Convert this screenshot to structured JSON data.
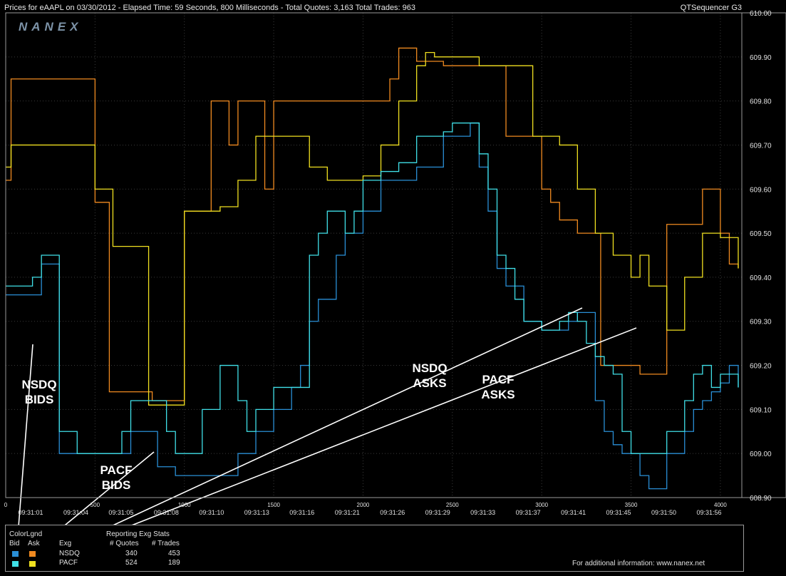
{
  "header": {
    "left_text": "Prices for  eAAPL  on  03/30/2012  -  Elapsed Time: 59 Seconds, 800 Milliseconds  -  Total Quotes: 3,163  Total Trades: 963",
    "right_text": "QTSequencer G3"
  },
  "logo": "NANEX",
  "colors": {
    "nsdq_bid": "#2a8fd6",
    "nsdq_ask": "#f08a20",
    "pacf_bid": "#40e0e8",
    "pacf_ask": "#f0e020",
    "annotation": "#ffffff"
  },
  "chart_data": {
    "type": "line",
    "title": "",
    "xlabel": "",
    "ylabel": "",
    "x_ticks": [
      0,
      500,
      1000,
      1500,
      2000,
      2500,
      3000,
      3500,
      4000
    ],
    "time_labels": [
      "09:31:01",
      "09:31:04",
      "09:31:05",
      "09:31:08",
      "09:31:10",
      "09:31:13",
      "09:31:16",
      "09:31:21",
      "09:31:26",
      "09:31:29",
      "09:31:33",
      "09:31:37",
      "09:31:41",
      "09:31:45",
      "09:31:50",
      "09:31:56"
    ],
    "y_ticks": [
      "608.90",
      "609.00",
      "609.10",
      "609.20",
      "609.30",
      "609.40",
      "609.50",
      "609.60",
      "609.70",
      "609.80",
      "609.90",
      "610.00"
    ],
    "xlim": [
      0,
      4120
    ],
    "ylim": [
      608.9,
      610.0
    ],
    "series": [
      {
        "name": "NSDQ Ask",
        "color": "#f08a20",
        "x": [
          0,
          30,
          140,
          500,
          560,
          580,
          650,
          820,
          860,
          900,
          1000,
          1100,
          1150,
          1200,
          1250,
          1300,
          1400,
          1450,
          1500,
          1600,
          1700,
          1800,
          1950,
          2050,
          2100,
          2150,
          2200,
          2250,
          2300,
          2400,
          2450,
          2550,
          2650,
          2700,
          2800,
          2850,
          2900,
          3000,
          3050,
          3100,
          3200,
          3300,
          3330,
          3400,
          3450,
          3550,
          3600,
          3700,
          3800,
          3850,
          3900,
          3950,
          4000,
          4050,
          4100
        ],
        "y": [
          609.62,
          609.85,
          609.85,
          609.57,
          609.57,
          609.14,
          609.14,
          609.12,
          609.12,
          609.12,
          609.55,
          609.55,
          609.8,
          609.8,
          609.7,
          609.8,
          609.8,
          609.6,
          609.8,
          609.8,
          609.8,
          609.8,
          609.8,
          609.8,
          609.8,
          609.85,
          609.92,
          609.92,
          609.89,
          609.89,
          609.88,
          609.88,
          609.88,
          609.88,
          609.72,
          609.72,
          609.72,
          609.6,
          609.57,
          609.53,
          609.5,
          609.5,
          609.2,
          609.2,
          609.2,
          609.18,
          609.18,
          609.52,
          609.52,
          609.52,
          609.6,
          609.6,
          609.5,
          609.43,
          609.42
        ]
      },
      {
        "name": "PACF Ask",
        "color": "#f0e020",
        "x": [
          0,
          30,
          60,
          300,
          450,
          500,
          600,
          800,
          860,
          900,
          1000,
          1050,
          1200,
          1300,
          1350,
          1400,
          1500,
          1600,
          1700,
          1800,
          1950,
          2000,
          2100,
          2200,
          2300,
          2350,
          2400,
          2500,
          2600,
          2650,
          2700,
          2800,
          2950,
          3000,
          3100,
          3200,
          3300,
          3400,
          3500,
          3550,
          3600,
          3700,
          3800,
          3900,
          3950,
          4000,
          4050,
          4100
        ],
        "y": [
          609.65,
          609.7,
          609.7,
          609.7,
          609.7,
          609.6,
          609.47,
          609.11,
          609.11,
          609.11,
          609.55,
          609.55,
          609.56,
          609.62,
          609.62,
          609.72,
          609.72,
          609.72,
          609.65,
          609.62,
          609.62,
          609.63,
          609.7,
          609.8,
          609.88,
          609.91,
          609.9,
          609.9,
          609.9,
          609.88,
          609.88,
          609.88,
          609.72,
          609.72,
          609.7,
          609.6,
          609.5,
          609.45,
          609.4,
          609.45,
          609.38,
          609.28,
          609.4,
          609.5,
          609.5,
          609.49,
          609.49,
          609.42
        ]
      },
      {
        "name": "NSDQ Bid",
        "color": "#2a8fd6",
        "x": [
          0,
          50,
          100,
          200,
          250,
          300,
          350,
          400,
          450,
          500,
          550,
          600,
          700,
          800,
          850,
          900,
          950,
          1000,
          1050,
          1100,
          1200,
          1300,
          1400,
          1500,
          1550,
          1600,
          1650,
          1700,
          1750,
          1800,
          1850,
          1900,
          1950,
          2000,
          2100,
          2200,
          2300,
          2400,
          2450,
          2500,
          2550,
          2600,
          2650,
          2700,
          2750,
          2800,
          2900,
          3000,
          3100,
          3150,
          3200,
          3250,
          3300,
          3350,
          3400,
          3450,
          3500,
          3550,
          3600,
          3700,
          3800,
          3850,
          3900,
          3950,
          4000,
          4050,
          4100
        ],
        "y": [
          609.36,
          609.36,
          609.36,
          609.43,
          609.43,
          609.0,
          609.0,
          609.0,
          609.0,
          609.0,
          609.0,
          609.0,
          609.05,
          609.05,
          608.97,
          608.97,
          608.95,
          608.95,
          608.95,
          608.95,
          608.95,
          609.0,
          609.05,
          609.1,
          609.1,
          609.15,
          609.2,
          609.3,
          609.35,
          609.35,
          609.45,
          609.5,
          609.5,
          609.55,
          609.62,
          609.62,
          609.65,
          609.65,
          609.72,
          609.72,
          609.72,
          609.75,
          609.65,
          609.55,
          609.42,
          609.38,
          609.3,
          609.28,
          609.28,
          609.3,
          609.32,
          609.32,
          609.12,
          609.05,
          609.02,
          609.0,
          609.0,
          608.95,
          608.92,
          609.0,
          609.05,
          609.1,
          609.12,
          609.14,
          609.16,
          609.2,
          609.15
        ]
      },
      {
        "name": "PACF Bid",
        "color": "#40e0e8",
        "x": [
          0,
          20,
          100,
          150,
          200,
          250,
          300,
          350,
          400,
          450,
          500,
          550,
          600,
          650,
          700,
          800,
          850,
          900,
          950,
          1000,
          1100,
          1200,
          1300,
          1350,
          1400,
          1450,
          1500,
          1600,
          1700,
          1750,
          1800,
          1850,
          1900,
          1950,
          2000,
          2100,
          2200,
          2300,
          2400,
          2450,
          2500,
          2550,
          2600,
          2650,
          2700,
          2750,
          2800,
          2850,
          2900,
          3000,
          3100,
          3150,
          3200,
          3250,
          3300,
          3350,
          3400,
          3450,
          3500,
          3550,
          3600,
          3700,
          3800,
          3850,
          3900,
          3950,
          4000,
          4100
        ],
        "y": [
          609.38,
          609.38,
          609.38,
          609.4,
          609.45,
          609.45,
          609.05,
          609.05,
          609.0,
          609.0,
          609.0,
          609.0,
          609.0,
          609.05,
          609.12,
          609.12,
          609.12,
          609.05,
          609.0,
          609.0,
          609.1,
          609.2,
          609.12,
          609.05,
          609.1,
          609.1,
          609.15,
          609.15,
          609.45,
          609.5,
          609.55,
          609.55,
          609.5,
          609.55,
          609.62,
          609.64,
          609.66,
          609.72,
          609.72,
          609.73,
          609.75,
          609.75,
          609.75,
          609.68,
          609.6,
          609.45,
          609.42,
          609.35,
          609.3,
          609.28,
          609.3,
          609.32,
          609.3,
          609.25,
          609.22,
          609.2,
          609.18,
          609.05,
          609.0,
          609.0,
          609.0,
          609.05,
          609.12,
          609.18,
          609.2,
          609.15,
          609.18,
          609.15
        ]
      }
    ]
  },
  "annotations": [
    {
      "id": "nsdq-bids",
      "lines": [
        "NSDQ",
        "BIDS"
      ]
    },
    {
      "id": "pacf-bids",
      "lines": [
        "PACF",
        "BIDS"
      ]
    },
    {
      "id": "nsdq-asks",
      "lines": [
        "NSDQ",
        "ASKS"
      ]
    },
    {
      "id": "pacf-asks",
      "lines": [
        "PACF",
        "ASKS"
      ]
    }
  ],
  "legend": {
    "title": "ColorLgnd",
    "bid_header": "Bid",
    "ask_header": "Ask",
    "exg_header": "Exg",
    "stats_title": "Reporting Exg Stats",
    "quotes_header": "# Quotes",
    "trades_header": "# Trades",
    "rows": [
      {
        "exchange": "NSDQ",
        "quotes": "340",
        "trades": "453"
      },
      {
        "exchange": "PACF",
        "quotes": "524",
        "trades": "189"
      }
    ]
  },
  "footer": "For additional information: www.nanex.net"
}
